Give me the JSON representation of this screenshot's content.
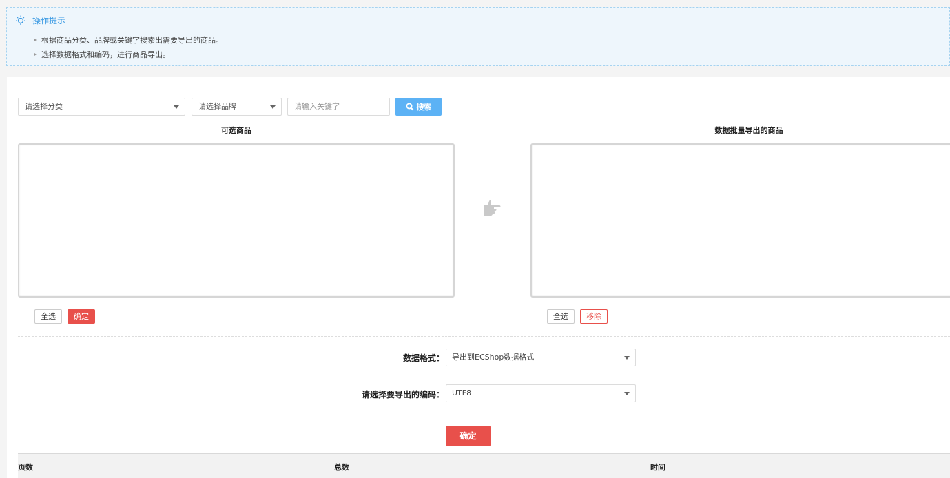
{
  "tips": {
    "title": "操作提示",
    "items": [
      "根据商品分类、品牌或关键字搜索出需要导出的商品。",
      "选择数据格式和编码，进行商品导出。"
    ]
  },
  "filters": {
    "category_value": "请选择分类",
    "brand_value": "请选择品牌",
    "keyword_placeholder": "请输入关键字",
    "search_label": "搜索"
  },
  "left_list": {
    "title": "可选商品",
    "select_all_label": "全选",
    "confirm_label": "确定"
  },
  "right_list": {
    "title": "数据批量导出的商品",
    "select_all_label": "全选",
    "remove_label": "移除"
  },
  "form": {
    "format_label": "数据格式：",
    "format_value": "导出到ECShop数据格式",
    "encoding_label": "请选择要导出的编码：",
    "encoding_value": "UTF8",
    "submit_label": "确定"
  },
  "table": {
    "columns": [
      "页数",
      "总数",
      "时间"
    ]
  },
  "colors": {
    "accent_blue": "#5cb2f5",
    "accent_red": "#e8504b",
    "tips_bg": "#eef6fc"
  }
}
